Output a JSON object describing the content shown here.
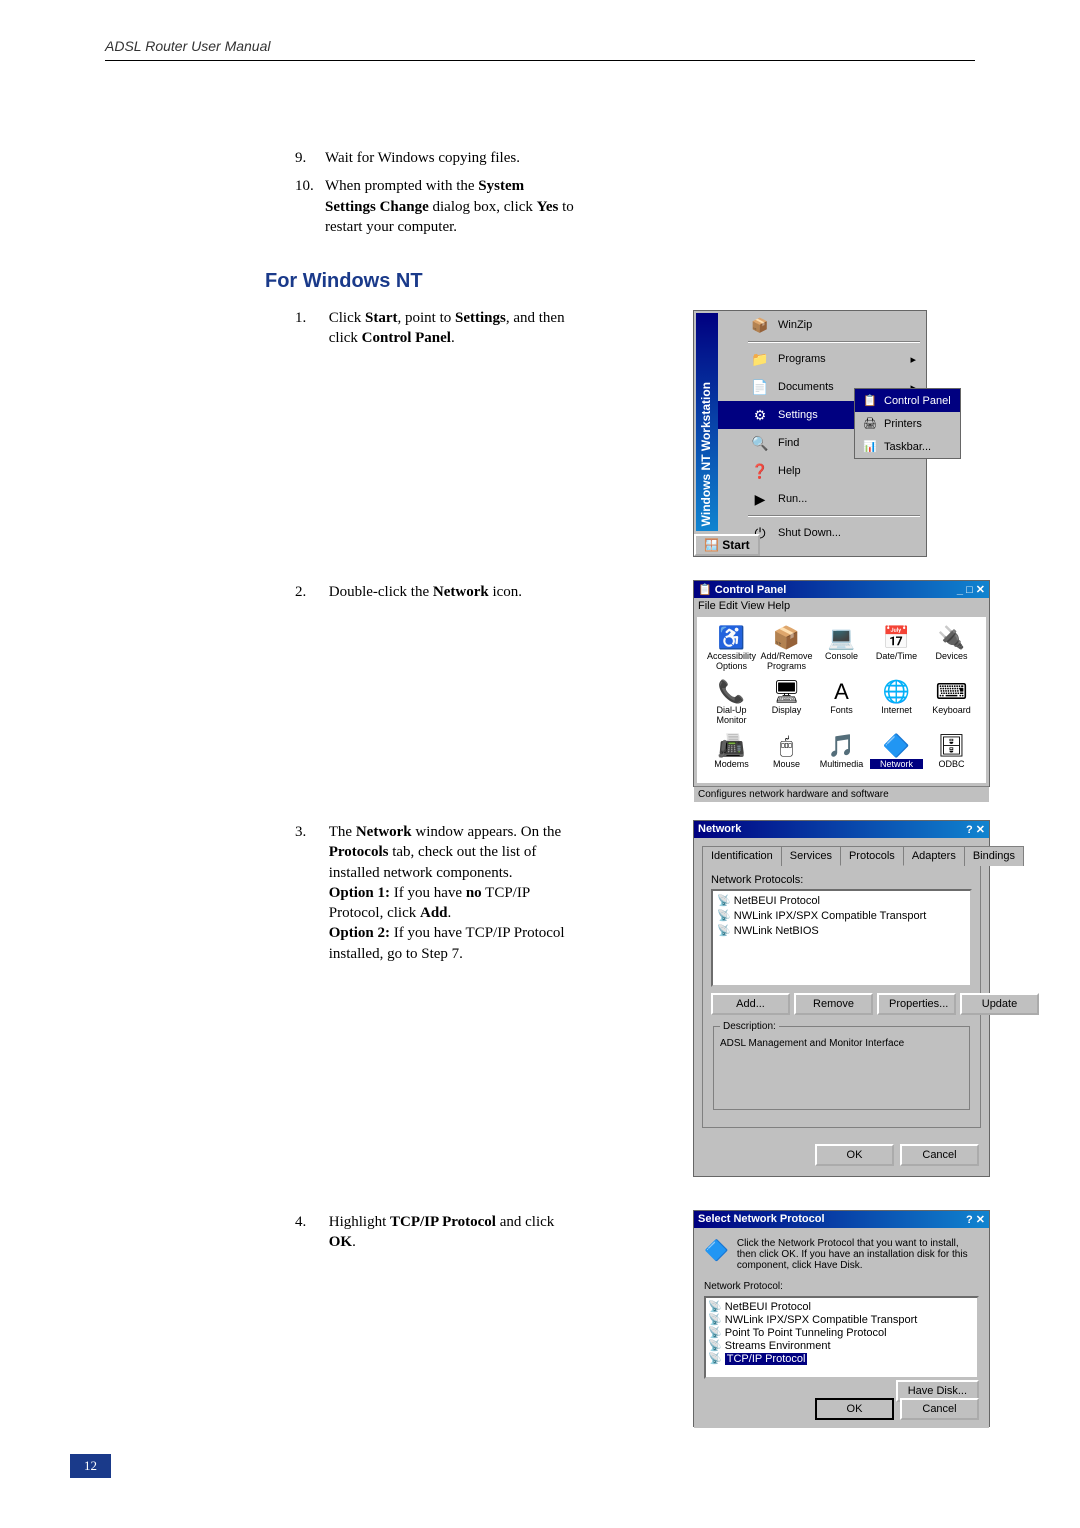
{
  "header": "ADSL Router User Manual",
  "page_number": "12",
  "steps": {
    "s9": {
      "num": "9.",
      "text_a": "Wait for Windows copying files."
    },
    "s10": {
      "num": "10.",
      "text_a": "When prompted with the ",
      "b1": "System Settings Change",
      "text_b": " dialog box, click ",
      "b2": "Yes",
      "text_c": " to restart your computer."
    },
    "heading": "For Windows NT",
    "s1": {
      "num": "1.",
      "text_a": "Click ",
      "b1": "Start",
      "text_b": ", point to ",
      "b2": "Settings",
      "text_c": ", and then click ",
      "b3": "Control Panel",
      "text_d": "."
    },
    "s2": {
      "num": "2.",
      "text_a": "Double-click the ",
      "b1": "Network",
      "text_b": " icon."
    },
    "s3": {
      "num": "3.",
      "text_a": "The ",
      "b1": "Network",
      "text_b": " window appears. On the ",
      "b2": "Protocols",
      "text_c": " tab, check out the list of installed network components.",
      "line2a": "Option 1:",
      "line2b": " If you have ",
      "line2c": "no",
      "line2d": " TCP/IP Protocol, click ",
      "line2e": "Add",
      "line2f": ".",
      "line3a": "Option 2:",
      "line3b": " If you have TCP/IP Protocol installed, go to Step 7."
    },
    "s4": {
      "num": "4.",
      "text_a": "Highlight ",
      "b1": "TCP/IP Protocol",
      "text_b": " and click ",
      "b2": "OK",
      "text_c": "."
    }
  },
  "startmenu": {
    "side": "Windows NT Workstation",
    "items": [
      "WinZip",
      "Programs",
      "Documents",
      "Settings",
      "Find",
      "Help",
      "Run...",
      "Shut Down..."
    ],
    "sub": [
      "Control Panel",
      "Printers",
      "Taskbar..."
    ],
    "start": "Start"
  },
  "controlpanel": {
    "title": "Control Panel",
    "menu": "File   Edit   View   Help",
    "items": [
      {
        "ico": "♿",
        "lbl": "Accessibility Options"
      },
      {
        "ico": "📦",
        "lbl": "Add/Remove Programs"
      },
      {
        "ico": "💻",
        "lbl": "Console"
      },
      {
        "ico": "📅",
        "lbl": "Date/Time"
      },
      {
        "ico": "🔌",
        "lbl": "Devices"
      },
      {
        "ico": "📞",
        "lbl": "Dial-Up Monitor"
      },
      {
        "ico": "🖥",
        "lbl": "Display"
      },
      {
        "ico": "A",
        "lbl": "Fonts"
      },
      {
        "ico": "🌐",
        "lbl": "Internet"
      },
      {
        "ico": "⌨",
        "lbl": "Keyboard"
      },
      {
        "ico": "📠",
        "lbl": "Modems"
      },
      {
        "ico": "🖱",
        "lbl": "Mouse"
      },
      {
        "ico": "🎵",
        "lbl": "Multimedia"
      },
      {
        "ico": "🔷",
        "lbl": "Network"
      },
      {
        "ico": "🗄",
        "lbl": "ODBC"
      }
    ],
    "status": "Configures network hardware and software"
  },
  "network": {
    "title": "Network",
    "tabs": [
      "Identification",
      "Services",
      "Protocols",
      "Adapters",
      "Bindings"
    ],
    "label": "Network Protocols:",
    "protocols": [
      "NetBEUI Protocol",
      "NWLink IPX/SPX Compatible Transport",
      "NWLink NetBIOS"
    ],
    "buttons": {
      "add": "Add...",
      "remove": "Remove",
      "props": "Properties...",
      "update": "Update"
    },
    "desc_label": "Description:",
    "desc": "ADSL Management and Monitor Interface",
    "ok": "OK",
    "cancel": "Cancel"
  },
  "selectproto": {
    "title": "Select Network Protocol",
    "msg": "Click the Network Protocol that you want to install, then click OK. If you have an installation disk for this component, click Have Disk.",
    "label": "Network Protocol:",
    "items": [
      "NetBEUI Protocol",
      "NWLink IPX/SPX Compatible Transport",
      "Point To Point Tunneling Protocol",
      "Streams Environment",
      "TCP/IP Protocol"
    ],
    "havedisk": "Have Disk...",
    "ok": "OK",
    "cancel": "Cancel"
  }
}
